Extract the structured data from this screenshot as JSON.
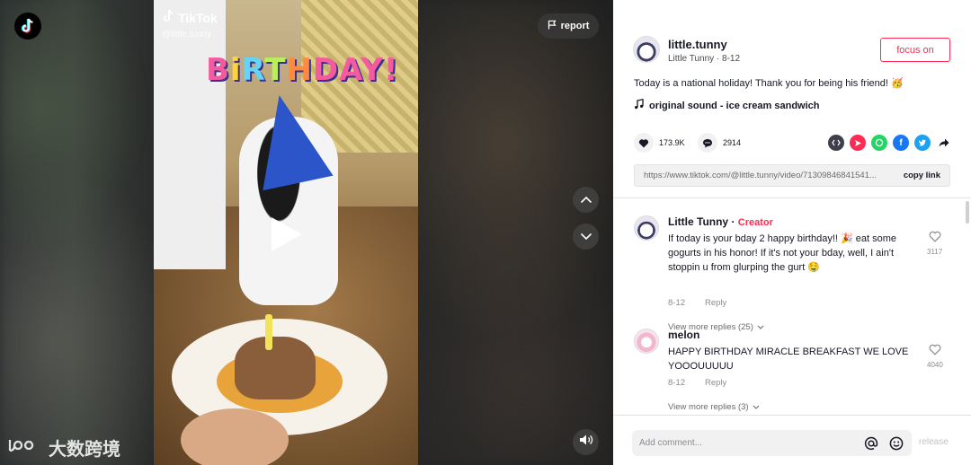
{
  "video": {
    "brand": "TikTok",
    "handle": "@little.tunny",
    "overlay_text": [
      "B",
      "i",
      "R",
      "T",
      "H",
      "D",
      "A",
      "Y",
      "!"
    ],
    "report_label": "report",
    "watermark": "大数跨境"
  },
  "author": {
    "username": "little.tunny",
    "subtitle": "Little Tunny · 8-12",
    "focus_label": "focus on"
  },
  "post": {
    "description": "Today is a national holiday! Thank you for being his friend! 🥳",
    "music": "original sound - ice cream sandwich"
  },
  "stats": {
    "likes": "173.9K",
    "comments": "2914"
  },
  "share_icons": [
    "embed-icon",
    "send-icon",
    "whatsapp-icon",
    "facebook-icon",
    "twitter-icon",
    "share-arrow-icon"
  ],
  "link": {
    "url": "https://www.tiktok.com/@little.tunny/video/71309846841541...",
    "copy_label": "copy link"
  },
  "comments": [
    {
      "name": "Little Tunny",
      "badge": "Creator",
      "text": "If today is your bday 2 happy birthday!! 🎉 eat some gogurts in his honor! If it's not your bday, well, I ain't stoppin u from glurping the gurt 🤤",
      "date": "8-12",
      "reply_label": "Reply",
      "likes": "3117",
      "view_replies": "View more replies (25)"
    },
    {
      "name": "melon",
      "badge": "",
      "text": "HAPPY BIRTHDAY MIRACLE BREAKFAST WE LOVE YOOOUUUUU",
      "date": "8-12",
      "reply_label": "Reply",
      "likes": "4040",
      "view_replies": "View more replies (3)"
    }
  ],
  "composer": {
    "placeholder": "Add comment...",
    "release_label": "release"
  },
  "colors": {
    "accent": "#fe2c55",
    "whatsapp": "#25d366",
    "facebook": "#1877f2",
    "twitter": "#1da1f2",
    "send": "#fe2c55",
    "embed": "#3d3f4a"
  }
}
